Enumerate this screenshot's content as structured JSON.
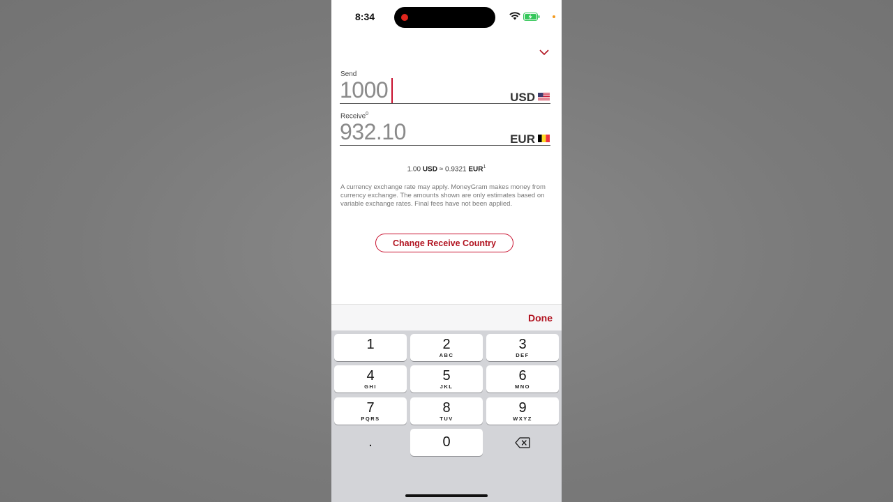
{
  "status": {
    "time": "8:34",
    "icons": [
      "recording-dot-icon",
      "wifi-icon",
      "battery-charging-icon",
      "privacy-dot-icon"
    ],
    "colors": {
      "record": "#e0261d",
      "battery": "#34c759",
      "privacy_dot": "#f39a1f"
    }
  },
  "header": {
    "collapse_icon": "chevron-down-icon"
  },
  "send": {
    "label": "Send",
    "amount": "1000",
    "currency": "USD",
    "flag_icon": "us-flag-icon"
  },
  "receive": {
    "label": "Receive",
    "footnote": "0",
    "amount": "932.10",
    "currency": "EUR",
    "flag_icon": "belgium-flag-icon"
  },
  "rate": {
    "from_amount": "1.00",
    "from_currency": "USD",
    "approx": "≈",
    "to_amount": "0.9321",
    "to_currency": "EUR",
    "footnote": "1"
  },
  "disclaimer": "A currency exchange rate may apply. MoneyGram makes money from currency exchange. The amounts shown are only estimates based on variable exchange rates. Final fees have not been applied.",
  "actions": {
    "change_country_label": "Change Receive Country"
  },
  "keyboard": {
    "done_label": "Done",
    "keys": [
      {
        "digit": "1",
        "letters": ""
      },
      {
        "digit": "2",
        "letters": "ABC"
      },
      {
        "digit": "3",
        "letters": "DEF"
      },
      {
        "digit": "4",
        "letters": "GHI"
      },
      {
        "digit": "5",
        "letters": "JKL"
      },
      {
        "digit": "6",
        "letters": "MNO"
      },
      {
        "digit": "7",
        "letters": "PQRS"
      },
      {
        "digit": "8",
        "letters": "TUV"
      },
      {
        "digit": "9",
        "letters": "WXYZ"
      }
    ],
    "decimal": ".",
    "zero": "0",
    "delete_icon": "backspace-icon"
  },
  "theme": {
    "accent": "#c8102e",
    "text": "#333333",
    "keyboard_bg": "#d3d4d8"
  }
}
